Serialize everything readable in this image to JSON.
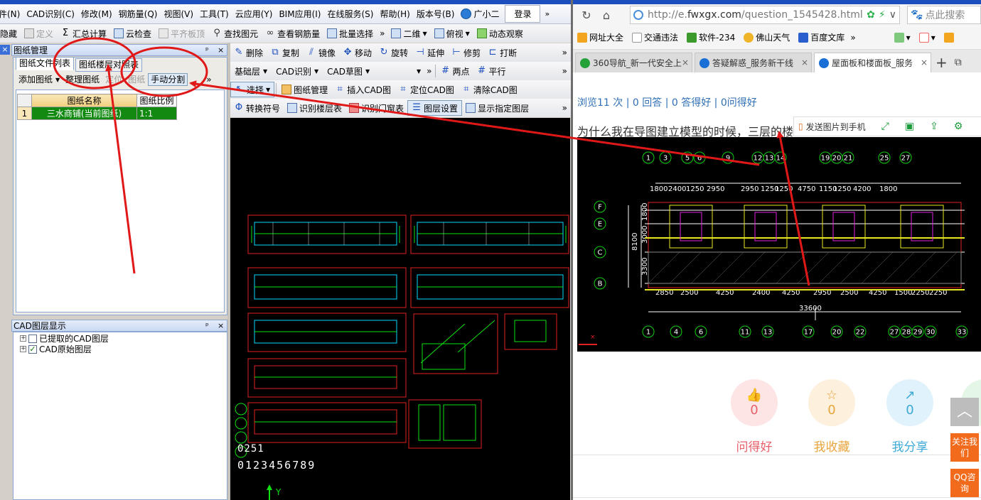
{
  "app": {
    "menu": [
      "件(N)",
      "CAD识别(C)",
      "修改(M)",
      "钢筋量(Q)",
      "视图(V)",
      "工具(T)",
      "云应用(Y)",
      "BIM应用(I)",
      "在线服务(S)",
      "帮助(H)",
      "版本号(B)"
    ],
    "assistant_label": "广小二",
    "login_label": "登录",
    "toolbar1": {
      "hide": "隐藏",
      "define": "定义",
      "sum": "汇总计算",
      "cloud_check": "云检查",
      "flat_board": "平齐板顶",
      "find_element": "查找图元",
      "view_rebar": "查看钢筋量",
      "batch_select": "批量选择",
      "view_2d": "二维",
      "view_mode": "俯视",
      "dynamic_view": "动态观察"
    },
    "edit_toolbar": {
      "delete": "删除",
      "copy": "复制",
      "mirror": "镜像",
      "move": "移动",
      "rotate": "旋转",
      "extend": "延伸",
      "trim": "修剪",
      "break": "打断"
    },
    "layer_toolbar": {
      "floor": "基础层",
      "cad_recog": "CAD识别",
      "cad_draft": "CAD草图",
      "two_points": "两点",
      "parallel": "平行"
    },
    "cad_toolbar": {
      "select": "选择",
      "drawing_mgmt": "图纸管理",
      "insert_cad": "插入CAD图",
      "locate_cad": "定位CAD图",
      "clear_cad": "清除CAD图"
    },
    "cad_toolbar2": {
      "convert_symbol": "转换符号",
      "recog_floor_table": "识别楼层表",
      "recog_door_window": "识别门窗表",
      "layer_settings": "图层设置",
      "show_layer": "显示指定图层"
    },
    "drawing_panel": {
      "title": "图纸管理",
      "tabs": [
        "图纸文件列表",
        "图纸楼层对照表"
      ],
      "tools": [
        "添加图纸",
        "整理图纸",
        "定位",
        "图纸",
        "手动分割"
      ],
      "columns": [
        "图纸名称",
        "图纸比例"
      ],
      "rows": [
        {
          "index": "1",
          "name": "三水商铺(当前图纸)",
          "scale": "1:1"
        }
      ]
    },
    "layer_panel": {
      "title": "CAD图层显示",
      "items": [
        {
          "label": "已提取的CAD图层",
          "checked": "false"
        },
        {
          "label": "CAD原始图层",
          "checked": "true"
        }
      ]
    },
    "cad_canvas": {
      "numbers_small": "0251",
      "numbers_big": "0123456789",
      "axis_y": "Y"
    }
  },
  "browser": {
    "url_host": "http://e.",
    "url_domain": "fwxgx.com",
    "url_path": "/question_1545428.html",
    "search_placeholder": "点此搜索",
    "bookmarks": [
      "网址大全",
      "交通违法",
      "软件-234",
      "佛山天气",
      "百度文库"
    ],
    "tabs": [
      "360导航_新一代安全上",
      "答疑解惑_服务新干线",
      "屋面板和楼面板_服务"
    ],
    "stats": "浏览11 次 | 0 回答 | 0 答得好 | 0问得好",
    "question": "为什么我在导图建立模型的时候，三层的楼",
    "image_toolbar": {
      "send_to_phone": "发送图片到手机"
    },
    "floor_plan": {
      "top_axes": [
        "1",
        "3",
        "5",
        "6",
        "9",
        "12",
        "13",
        "14",
        "19",
        "20",
        "21",
        "25",
        "27"
      ],
      "top_dims": [
        "1800",
        "2400",
        "1250",
        "2950",
        "2950",
        "1250",
        "1250",
        "4750",
        "1150",
        "1250",
        "4200",
        "1800"
      ],
      "left_axes": [
        "F",
        "E",
        "C",
        "B"
      ],
      "left_dims": [
        "1800",
        "3000",
        "3300"
      ],
      "overall_depth": "8100",
      "overall_length": "33600",
      "bottom_axes": [
        "1",
        "4",
        "6",
        "11",
        "13",
        "17",
        "20",
        "22",
        "27",
        "28",
        "29",
        "30",
        "33"
      ],
      "bottom_dims": [
        "2850",
        "2500",
        "4250",
        "2400",
        "4250",
        "2950",
        "2500",
        "4250",
        "1500",
        "2250",
        "2250"
      ]
    },
    "actions": [
      {
        "label": "问得好",
        "count": "0",
        "color": "#e8606a",
        "bg": "#fde5e5"
      },
      {
        "label": "我收藏",
        "count": "0",
        "color": "#e9a53c",
        "bg": "#fdf0dc"
      },
      {
        "label": "我分享",
        "count": "0",
        "color": "#3ea9d8",
        "bg": "#e0f2fb"
      }
    ],
    "side": {
      "follow": "关注我们",
      "qq": "QQ咨询"
    }
  }
}
